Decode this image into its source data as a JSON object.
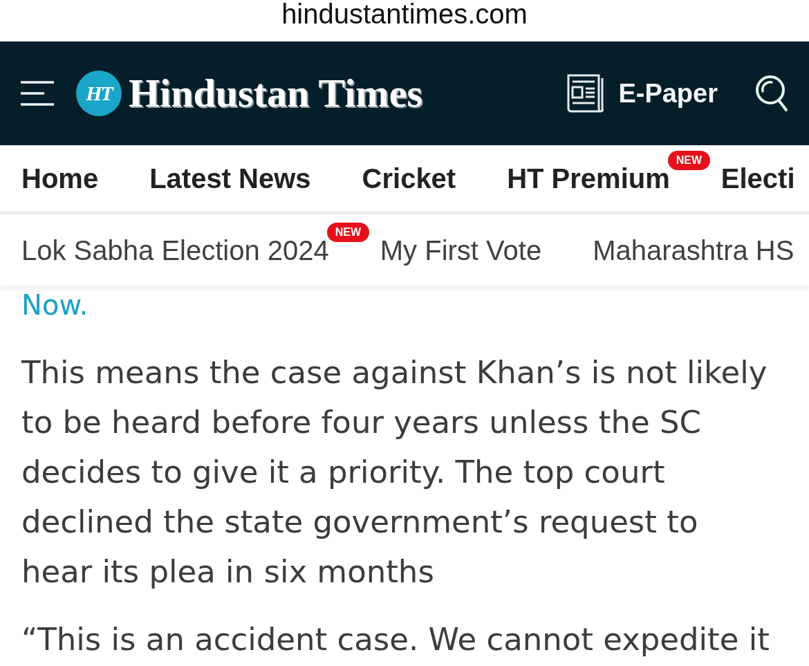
{
  "browser": {
    "url": "hindustantimes.com"
  },
  "header": {
    "logo_mark": "HT",
    "logo_text": "Hindustan Times",
    "epaper_label": "E-Paper"
  },
  "primary_nav": [
    {
      "label": "Home"
    },
    {
      "label": "Latest News"
    },
    {
      "label": "Cricket"
    },
    {
      "label": "HT Premium",
      "badge": "NEW"
    },
    {
      "label": "Electi"
    }
  ],
  "secondary_nav": [
    {
      "label": "Lok Sabha Election 2024",
      "badge": "NEW"
    },
    {
      "label": "My First Vote"
    },
    {
      "label": "Maharashtra HS"
    }
  ],
  "article": {
    "link_tail": "Now.",
    "paragraphs": [
      "This means the case against Khan’s is not likely to be heard before four years unless the SC decides to give it a priority. The top court declined the state government’s request to hear its plea in six months",
      "“This is an accident case. We cannot expedite it"
    ]
  }
}
